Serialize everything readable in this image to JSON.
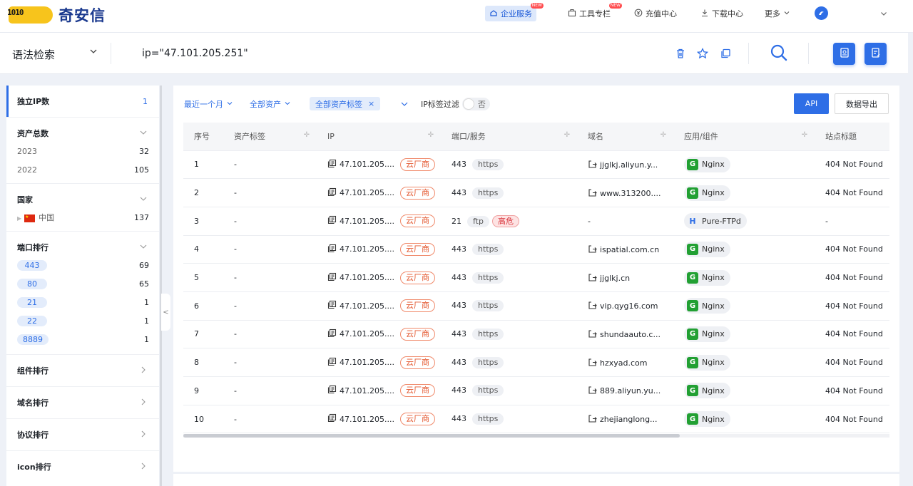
{
  "brand": {
    "name": "奇安信",
    "mark_text": "1010"
  },
  "nav": {
    "items": [
      {
        "label": "企业服务",
        "new": "NEW"
      },
      {
        "label": "工具专栏",
        "new": "NEW"
      },
      {
        "label": "充值中心"
      },
      {
        "label": "下载中心"
      },
      {
        "label": "更多"
      }
    ]
  },
  "search": {
    "mode": "语法检索",
    "query": "ip=\"47.101.205.251\""
  },
  "sidebar": {
    "independent_ip": {
      "label": "独立IP数",
      "count": "1"
    },
    "asset_total": {
      "label": "资产总数",
      "rows": [
        {
          "label": "2023",
          "num": "32"
        },
        {
          "label": "2022",
          "num": "105"
        }
      ]
    },
    "country": {
      "label": "国家",
      "rows": [
        {
          "label": "中国",
          "num": "137"
        }
      ]
    },
    "port_rank": {
      "label": "端口排行",
      "rows": [
        {
          "label": "443",
          "num": "69"
        },
        {
          "label": "80",
          "num": "65"
        },
        {
          "label": "21",
          "num": "1"
        },
        {
          "label": "22",
          "num": "1"
        },
        {
          "label": "8889",
          "num": "1"
        }
      ]
    },
    "component_rank": {
      "label": "组件排行"
    },
    "domain_rank": {
      "label": "域名排行"
    },
    "protocol_rank": {
      "label": "协议排行"
    },
    "icon_rank": {
      "label": "icon排行"
    },
    "collapse": "<"
  },
  "filters": {
    "time": "最近一个月",
    "assets": "全部资产",
    "tags": "全部资产标签",
    "ip_tag_filter": "IP标签过滤",
    "toggle_value": "否",
    "api": "API",
    "export": "数据导出"
  },
  "table": {
    "headers": [
      "序号",
      "资产标签",
      "IP",
      "端口/服务",
      "域名",
      "应用/组件",
      "站点标题"
    ],
    "rows": [
      {
        "no": "1",
        "tag": "-",
        "ip": "47.101.205....",
        "cloud": "云厂商",
        "port": "443",
        "svc": "https",
        "danger": "",
        "domain": "jjglkj.aliyun.y...",
        "comp": "Nginx",
        "comp_type": "g",
        "title": "404 Not Found"
      },
      {
        "no": "2",
        "tag": "-",
        "ip": "47.101.205....",
        "cloud": "云厂商",
        "port": "443",
        "svc": "https",
        "danger": "",
        "domain": "www.313200....",
        "comp": "Nginx",
        "comp_type": "g",
        "title": "404 Not Found"
      },
      {
        "no": "3",
        "tag": "-",
        "ip": "47.101.205....",
        "cloud": "云厂商",
        "port": "21",
        "svc": "ftp",
        "danger": "高危",
        "domain": "-",
        "comp": "Pure-FTPd",
        "comp_type": "h",
        "title": "-"
      },
      {
        "no": "4",
        "tag": "-",
        "ip": "47.101.205....",
        "cloud": "云厂商",
        "port": "443",
        "svc": "https",
        "danger": "",
        "domain": "ispatial.com.cn",
        "comp": "Nginx",
        "comp_type": "g",
        "title": "404 Not Found"
      },
      {
        "no": "5",
        "tag": "-",
        "ip": "47.101.205....",
        "cloud": "云厂商",
        "port": "443",
        "svc": "https",
        "danger": "",
        "domain": "jjglkj.cn",
        "comp": "Nginx",
        "comp_type": "g",
        "title": "404 Not Found"
      },
      {
        "no": "6",
        "tag": "-",
        "ip": "47.101.205....",
        "cloud": "云厂商",
        "port": "443",
        "svc": "https",
        "danger": "",
        "domain": "vip.qyg16.com",
        "comp": "Nginx",
        "comp_type": "g",
        "title": "404 Not Found"
      },
      {
        "no": "7",
        "tag": "-",
        "ip": "47.101.205....",
        "cloud": "云厂商",
        "port": "443",
        "svc": "https",
        "danger": "",
        "domain": "shundaauto.c...",
        "comp": "Nginx",
        "comp_type": "g",
        "title": "404 Not Found"
      },
      {
        "no": "8",
        "tag": "-",
        "ip": "47.101.205....",
        "cloud": "云厂商",
        "port": "443",
        "svc": "https",
        "danger": "",
        "domain": "hzxyad.com",
        "comp": "Nginx",
        "comp_type": "g",
        "title": "404 Not Found"
      },
      {
        "no": "9",
        "tag": "-",
        "ip": "47.101.205....",
        "cloud": "云厂商",
        "port": "443",
        "svc": "https",
        "danger": "",
        "domain": "889.aliyun.yu...",
        "comp": "Nginx",
        "comp_type": "g",
        "title": "404 Not Found"
      },
      {
        "no": "10",
        "tag": "-",
        "ip": "47.101.205....",
        "cloud": "云厂商",
        "port": "443",
        "svc": "https",
        "danger": "",
        "domain": "zhejianglong...",
        "comp": "Nginx",
        "comp_type": "g",
        "title": "404 Not Found"
      }
    ]
  }
}
